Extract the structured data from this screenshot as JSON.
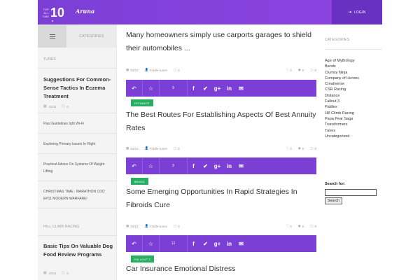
{
  "header": {
    "logo_small": "TOP ALL TIME",
    "logo_big": "10",
    "brand": "Aruna",
    "login_label": "LOGIN"
  },
  "left_sidebar": {
    "categories_label": "CATEGORIES",
    "section1": "TUNES",
    "feature1": {
      "title": "Suggestions For Common-Sense Tactics In Eczema Treatment",
      "date": "22/11",
      "comments": "0"
    },
    "items1": [
      "Past Guidelines Iqht Wi-Fi",
      "Exploring Primary Issues In Flight",
      "Practical Advice On Systems Of Weight Lifting",
      "CHRISTMAS TIME : MARATHON COD EP11 MODERN WARFARE!"
    ],
    "section2": "HILL CLIMB RACING",
    "feature2": {
      "title": "Basic Tips On Valuable Dog Food Review Programs",
      "date": "29/11",
      "comments": "0"
    }
  },
  "posts": [
    {
      "title": "Many homeowners simply use carports garages to shield their automobiles ...",
      "date": "03/10",
      "author": "Fiddle-tunes",
      "comments": "0",
      "likes": "0",
      "views": "0",
      "shares": "9",
      "tag": "DISTANCE"
    },
    {
      "title": "The Best Routes For Establishing Aspects Of Best Annuity Rates",
      "date": "03/10",
      "author": "Fiddle-tunes",
      "comments": "0",
      "likes": "0",
      "views": "0",
      "shares": "9",
      "tag": "BANDS"
    },
    {
      "title": "Some Emerging Opportunities In Rapid Strategies In Fibroids Cure",
      "date": "03/10",
      "author": "Fiddle-tunes",
      "comments": "0",
      "likes": "0",
      "views": "0",
      "shares": "12",
      "tag": "FALLOUT 3"
    },
    {
      "title": "Car Insurance Emotional Distress"
    }
  ],
  "right_sidebar": {
    "categories_label": "CATEGORIES",
    "categories": [
      "Age of Mythology",
      "Bands",
      "Clumsy Ninja",
      "Company of Heroes",
      "Creativerse",
      "CSR Racing",
      "Distance",
      "Fallout 3",
      "Fiddles",
      "Hill Climb Racing",
      "Papa Pear Saga",
      "Transformers",
      "Tunes",
      "Uncategorized"
    ],
    "search_label": "Search for:",
    "search_value": "",
    "search_button": "Search"
  },
  "colors": {
    "accent": "#7b3fd6",
    "tag": "#27ae60",
    "login_bg": "#6a30c2"
  }
}
